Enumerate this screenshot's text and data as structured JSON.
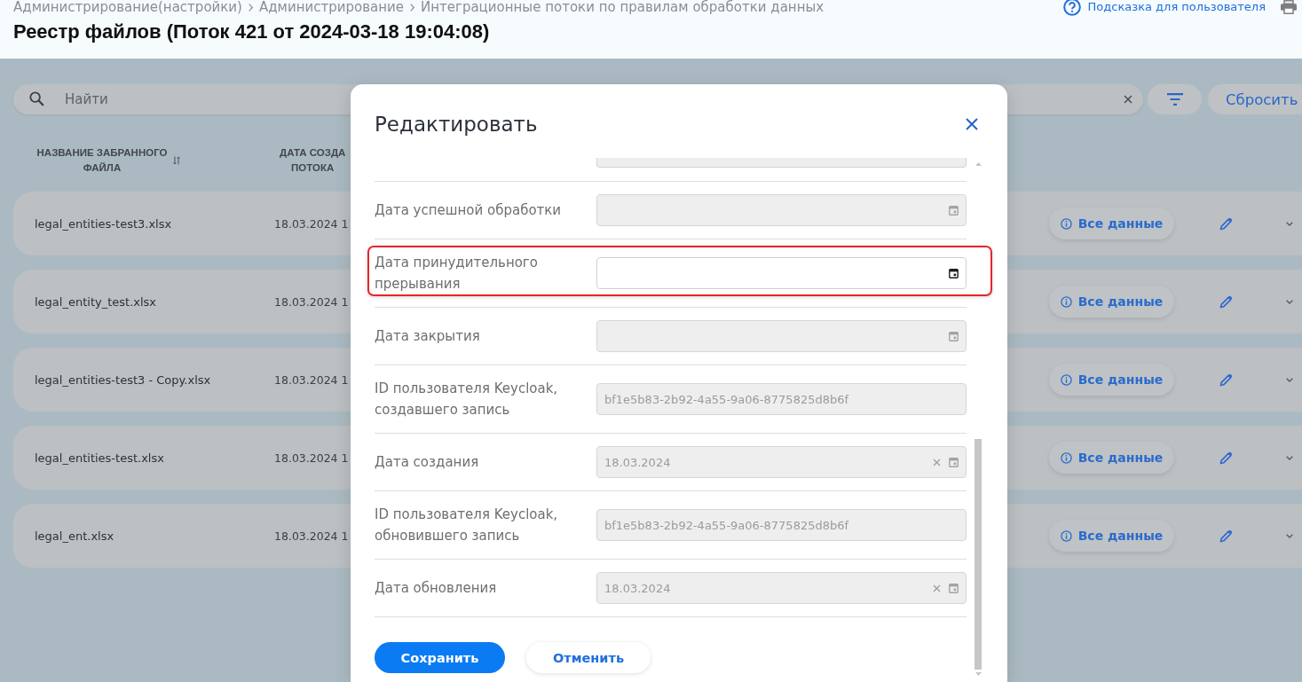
{
  "header": {
    "breadcrumbs": [
      "Администрирование(настройки)",
      "Администрирование",
      "Интеграционные потоки по правилам обработки данных"
    ],
    "help_link": "Подсказка для пользователя",
    "title": "Реестр файлов (Поток 421 от 2024-03-18 19:04:08)"
  },
  "toolbar": {
    "search": {
      "placeholder": "Найти"
    },
    "reset_button": "Сбросить"
  },
  "table": {
    "columns": [
      {
        "lines": [
          "НАЗВАНИЕ ЗАБРАННОГО",
          "ФАЙЛА"
        ],
        "sortable": true
      },
      {
        "lines": [
          "ДАТА СОЗДА",
          "ПОТОКА"
        ],
        "sortable": false
      }
    ],
    "rows": [
      {
        "file_name": "legal_entities-test3.xlsx",
        "created": "18.03.2024 1",
        "details_button": "Все данные"
      },
      {
        "file_name": "legal_entity_test.xlsx",
        "created": "18.03.2024 1",
        "details_button": "Все данные"
      },
      {
        "file_name": "legal_entities-test3 - Copy.xlsx",
        "created": "18.03.2024 1",
        "details_button": "Все данные"
      },
      {
        "file_name": "legal_entities-test.xlsx",
        "created": "18.03.2024 1",
        "details_button": "Все данные"
      },
      {
        "file_name": "legal_ent.xlsx",
        "created": "18.03.2024 1",
        "details_button": "Все данные"
      }
    ]
  },
  "modal": {
    "title": "Редактировать",
    "fields": [
      {
        "kind": "partial",
        "disabled": true,
        "clearable": false,
        "highlighted": false
      },
      {
        "kind": "date",
        "label": "Дата успешной обработки",
        "disabled": true,
        "clearable": false,
        "highlighted": false
      },
      {
        "kind": "date",
        "label": "Дата принудительного прерывания",
        "disabled": false,
        "clearable": false,
        "highlighted": true
      },
      {
        "kind": "date",
        "label": "Дата закрытия",
        "disabled": true,
        "clearable": false,
        "highlighted": false
      },
      {
        "kind": "text",
        "label": "ID пользователя Keycloak, создавшего запись",
        "value": "bf1e5b83-2b92-4a55-9a06-8775825d8b6f",
        "disabled": true,
        "clearable": false,
        "highlighted": false
      },
      {
        "kind": "date",
        "label": "Дата создания",
        "value": "18.03.2024",
        "disabled": true,
        "clearable": true,
        "highlighted": false
      },
      {
        "kind": "text",
        "label": "ID пользователя Keycloak, обновившего запись",
        "value": "bf1e5b83-2b92-4a55-9a06-8775825d8b6f",
        "disabled": true,
        "clearable": false,
        "highlighted": false
      },
      {
        "kind": "date",
        "label": "Дата обновления",
        "value": "18.03.2024",
        "disabled": true,
        "clearable": true,
        "highlighted": false
      }
    ],
    "buttons": [
      {
        "kind": "primary",
        "label": "Сохранить"
      },
      {
        "kind": "secondary",
        "label": "Отменить"
      }
    ]
  }
}
